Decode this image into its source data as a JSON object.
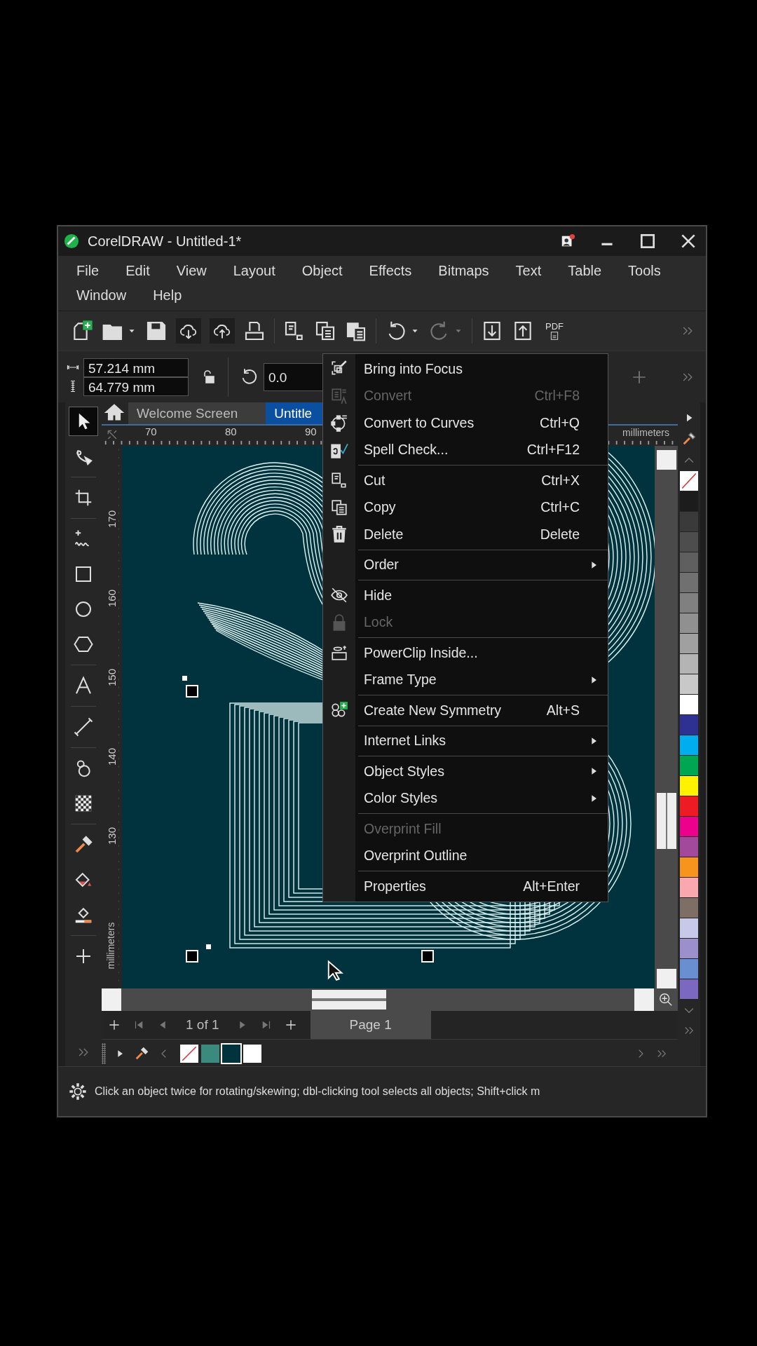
{
  "window": {
    "title": "CorelDRAW - Untitled-1*"
  },
  "menu_bar": [
    "File",
    "Edit",
    "View",
    "Layout",
    "Object",
    "Effects",
    "Bitmaps",
    "Text",
    "Table",
    "Tools",
    "Window",
    "Help"
  ],
  "toolbar": {
    "pdf_label": "PDF"
  },
  "property_bar": {
    "width": "57.214 mm",
    "height": "64.779 mm",
    "angle": "0.0"
  },
  "tools": [
    {
      "selected": true
    },
    {
      "selected": false
    },
    {
      "selected": false
    },
    {
      "selected": false
    },
    {
      "selected": false
    },
    {
      "selected": false
    },
    {
      "selected": false
    },
    {
      "selected": false
    },
    {
      "selected": false
    },
    {
      "selected": false
    },
    {
      "selected": false
    },
    {
      "selected": false
    },
    {
      "selected": false
    },
    {
      "selected": false
    },
    {
      "selected": false
    }
  ],
  "document_tabs": [
    {
      "label": "Welcome Screen",
      "selected": false
    },
    {
      "label": "Untitle",
      "selected": true
    }
  ],
  "rulers": {
    "horizontal": [
      "70",
      "80",
      "90"
    ],
    "horizontal_unit": "millimeters",
    "vertical": [
      "170",
      "160",
      "150",
      "140",
      "130"
    ],
    "vertical_unit": "millimeters"
  },
  "context_menu": {
    "groups": [
      [
        {
          "label": "Bring into Focus",
          "disabled": false,
          "submenu": false
        },
        {
          "label": "Convert",
          "shortcut": "Ctrl+F8",
          "disabled": true,
          "submenu": false
        },
        {
          "label": "Convert to Curves",
          "shortcut": "Ctrl+Q",
          "disabled": false,
          "submenu": false
        },
        {
          "label": "Spell Check...",
          "shortcut": "Ctrl+F12",
          "disabled": false,
          "submenu": false
        }
      ],
      [
        {
          "label": "Cut",
          "shortcut": "Ctrl+X",
          "disabled": false,
          "submenu": false
        },
        {
          "label": "Copy",
          "shortcut": "Ctrl+C",
          "disabled": false,
          "submenu": false
        },
        {
          "label": "Delete",
          "shortcut": "Delete",
          "disabled": false,
          "submenu": false
        }
      ],
      [
        {
          "label": "Order",
          "disabled": false,
          "submenu": true
        }
      ],
      [
        {
          "label": "Hide",
          "disabled": false,
          "submenu": false
        },
        {
          "label": "Lock",
          "disabled": true,
          "submenu": false
        }
      ],
      [
        {
          "label": "PowerClip Inside...",
          "disabled": false,
          "submenu": false
        },
        {
          "label": "Frame Type",
          "disabled": false,
          "submenu": true
        }
      ],
      [
        {
          "label": "Create New Symmetry",
          "shortcut": "Alt+S",
          "disabled": false,
          "submenu": false
        }
      ],
      [
        {
          "label": "Internet Links",
          "disabled": false,
          "submenu": true
        }
      ],
      [
        {
          "label": "Object Styles",
          "disabled": false,
          "submenu": true
        },
        {
          "label": "Color Styles",
          "disabled": false,
          "submenu": true
        }
      ],
      [
        {
          "label": "Overprint Fill",
          "disabled": true,
          "submenu": false
        },
        {
          "label": "Overprint Outline",
          "disabled": false,
          "submenu": false
        }
      ],
      [
        {
          "label": "Properties",
          "shortcut": "Alt+Enter",
          "disabled": false,
          "submenu": false
        }
      ]
    ]
  },
  "page_navigator": {
    "position": "1 of 1",
    "page_tabs": [
      {
        "label": "Page 1",
        "selected": true
      }
    ]
  },
  "document_palette": [
    {
      "kind": "none",
      "selected": false
    },
    {
      "kind": "color",
      "color": "#3a8a7e",
      "selected": false
    },
    {
      "kind": "color",
      "color": "#00333d",
      "selected": true
    },
    {
      "kind": "color",
      "color": "#ffffff",
      "selected": false
    }
  ],
  "color_palette": [
    {
      "kind": "none"
    },
    {
      "kind": "color",
      "color": "#1c1c1c"
    },
    {
      "kind": "color",
      "color": "#3a3a3a"
    },
    {
      "kind": "color",
      "color": "#4d4d4d"
    },
    {
      "kind": "color",
      "color": "#5f5f5f"
    },
    {
      "kind": "color",
      "color": "#707070"
    },
    {
      "kind": "color",
      "color": "#808080"
    },
    {
      "kind": "color",
      "color": "#909090"
    },
    {
      "kind": "color",
      "color": "#a0a0a0"
    },
    {
      "kind": "color",
      "color": "#b4b4b4"
    },
    {
      "kind": "color",
      "color": "#c8c8c8"
    },
    {
      "kind": "color",
      "color": "#ffffff"
    },
    {
      "kind": "color",
      "color": "#2e3192"
    },
    {
      "kind": "color",
      "color": "#00aeef"
    },
    {
      "kind": "color",
      "color": "#00a651"
    },
    {
      "kind": "color",
      "color": "#fff200"
    },
    {
      "kind": "color",
      "color": "#ed1c24"
    },
    {
      "kind": "color",
      "color": "#ec008c"
    },
    {
      "kind": "color",
      "color": "#a3499b"
    },
    {
      "kind": "color",
      "color": "#f7941d"
    },
    {
      "kind": "color",
      "color": "#f9a8b0"
    },
    {
      "kind": "color",
      "color": "#7d6e66"
    },
    {
      "kind": "color",
      "color": "#c8c8e8"
    },
    {
      "kind": "color",
      "color": "#9b8fcc"
    },
    {
      "kind": "color",
      "color": "#6a8fd1"
    },
    {
      "kind": "color",
      "color": "#7b68c0"
    }
  ],
  "status_bar": {
    "message": "Click an object twice for rotating/skewing; dbl-clicking tool selects all objects; Shift+click m"
  }
}
